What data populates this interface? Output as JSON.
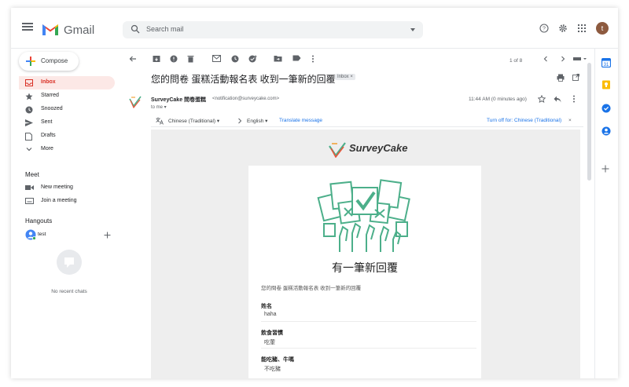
{
  "app": {
    "brand": "Gmail"
  },
  "search": {
    "placeholder": "Search mail"
  },
  "user": {
    "avatar_letter": "t"
  },
  "sidebar": {
    "compose_label": "Compose",
    "items": [
      {
        "label": "Inbox",
        "icon": "inbox-icon",
        "active": true
      },
      {
        "label": "Starred",
        "icon": "star-icon"
      },
      {
        "label": "Snoozed",
        "icon": "clock-icon"
      },
      {
        "label": "Sent",
        "icon": "send-icon"
      },
      {
        "label": "Drafts",
        "icon": "draft-icon"
      },
      {
        "label": "More",
        "icon": "chevron-down-icon"
      }
    ],
    "meet_title": "Meet",
    "meet_items": [
      {
        "label": "New meeting",
        "icon": "video-icon"
      },
      {
        "label": "Join a meeting",
        "icon": "keyboard-icon"
      }
    ],
    "hangouts_title": "Hangouts",
    "hangouts_user": "test",
    "no_chats": "No recent chats"
  },
  "toolbar": {
    "pager": "1 of 8"
  },
  "message": {
    "subject": "您的問卷 蛋糕活動報名表 收到一筆新的回覆",
    "label_badge": "Inbox",
    "sender_name": "SurveyCake 問卷蛋糕",
    "sender_address": "<notification@surveycake.com>",
    "to": "to me",
    "time": "11:44 AM (0 minutes ago)"
  },
  "translate": {
    "from_lang": "Chinese (Traditional)",
    "to_lang": "English",
    "translate_link": "Translate message",
    "turn_off": "Turn off for: Chinese (Traditional)"
  },
  "email": {
    "logo_text": "SurveyCake",
    "heading": "有一筆新回覆",
    "description": "您的問卷 蛋糕活動報名表 收到一筆新的回覆",
    "fields": [
      {
        "label": "姓名",
        "value": "haha"
      },
      {
        "label": "飲食習慣",
        "value": "吃葷"
      },
      {
        "label": "能吃豬、牛嗎",
        "value": "不吃豬"
      }
    ]
  },
  "colors": {
    "accent": "#d93025",
    "link": "#1a73e8",
    "brand_green": "#4caf8a"
  }
}
